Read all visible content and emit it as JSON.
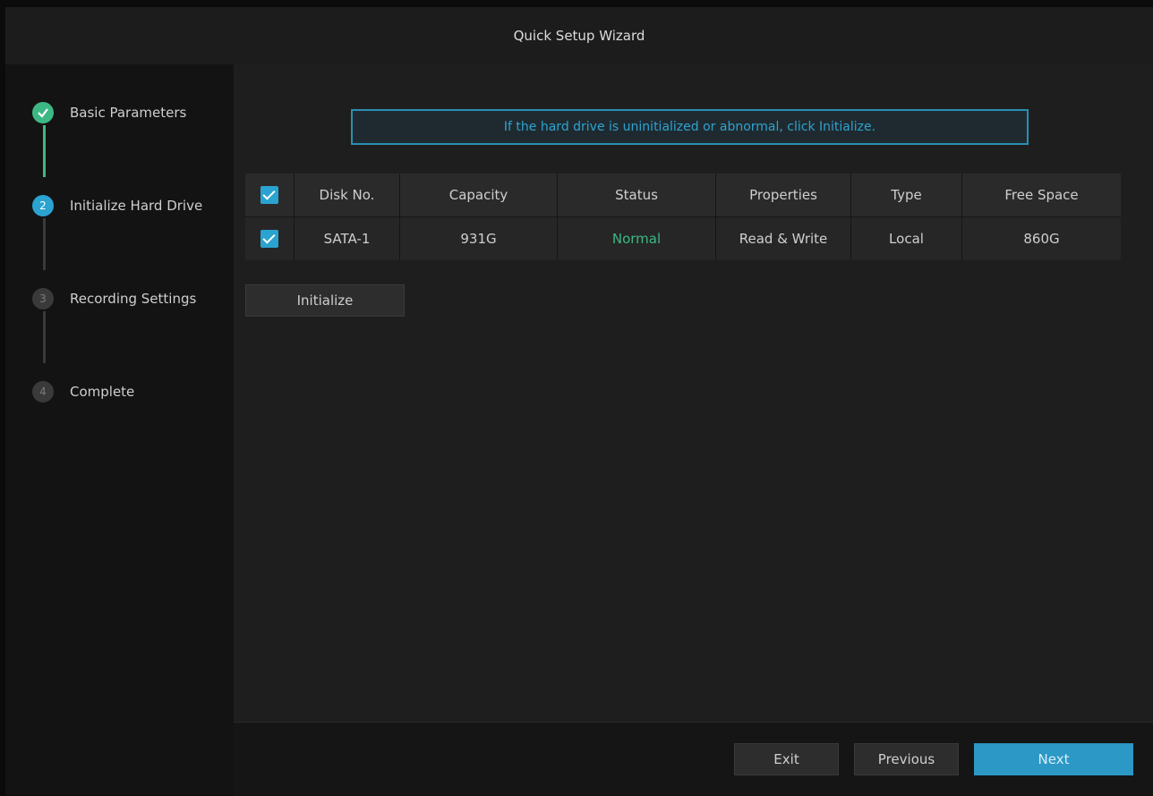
{
  "window": {
    "title": "Quick Setup Wizard"
  },
  "steps": [
    {
      "label": "Basic Parameters",
      "state": "done",
      "icon": "check-icon"
    },
    {
      "label": "Initialize Hard Drive",
      "number": "2",
      "state": "active"
    },
    {
      "label": "Recording Settings",
      "number": "3",
      "state": "pending"
    },
    {
      "label": "Complete",
      "number": "4",
      "state": "pending"
    }
  ],
  "notice": "If the hard drive is uninitialized or abnormal, click Initialize.",
  "table": {
    "columns": [
      "Disk No.",
      "Capacity",
      "Status",
      "Properties",
      "Type",
      "Free Space"
    ],
    "rows": [
      {
        "checked": true,
        "disk_no": "SATA-1",
        "capacity": "931G",
        "status": "Normal",
        "properties": "Read & Write",
        "type": "Local",
        "free_space": "860G"
      }
    ]
  },
  "buttons": {
    "initialize": "Initialize",
    "exit": "Exit",
    "previous": "Previous",
    "next": "Next"
  },
  "colors": {
    "accent": "#2ba3d1",
    "success": "#3db884",
    "background": "#1e1e1e"
  }
}
